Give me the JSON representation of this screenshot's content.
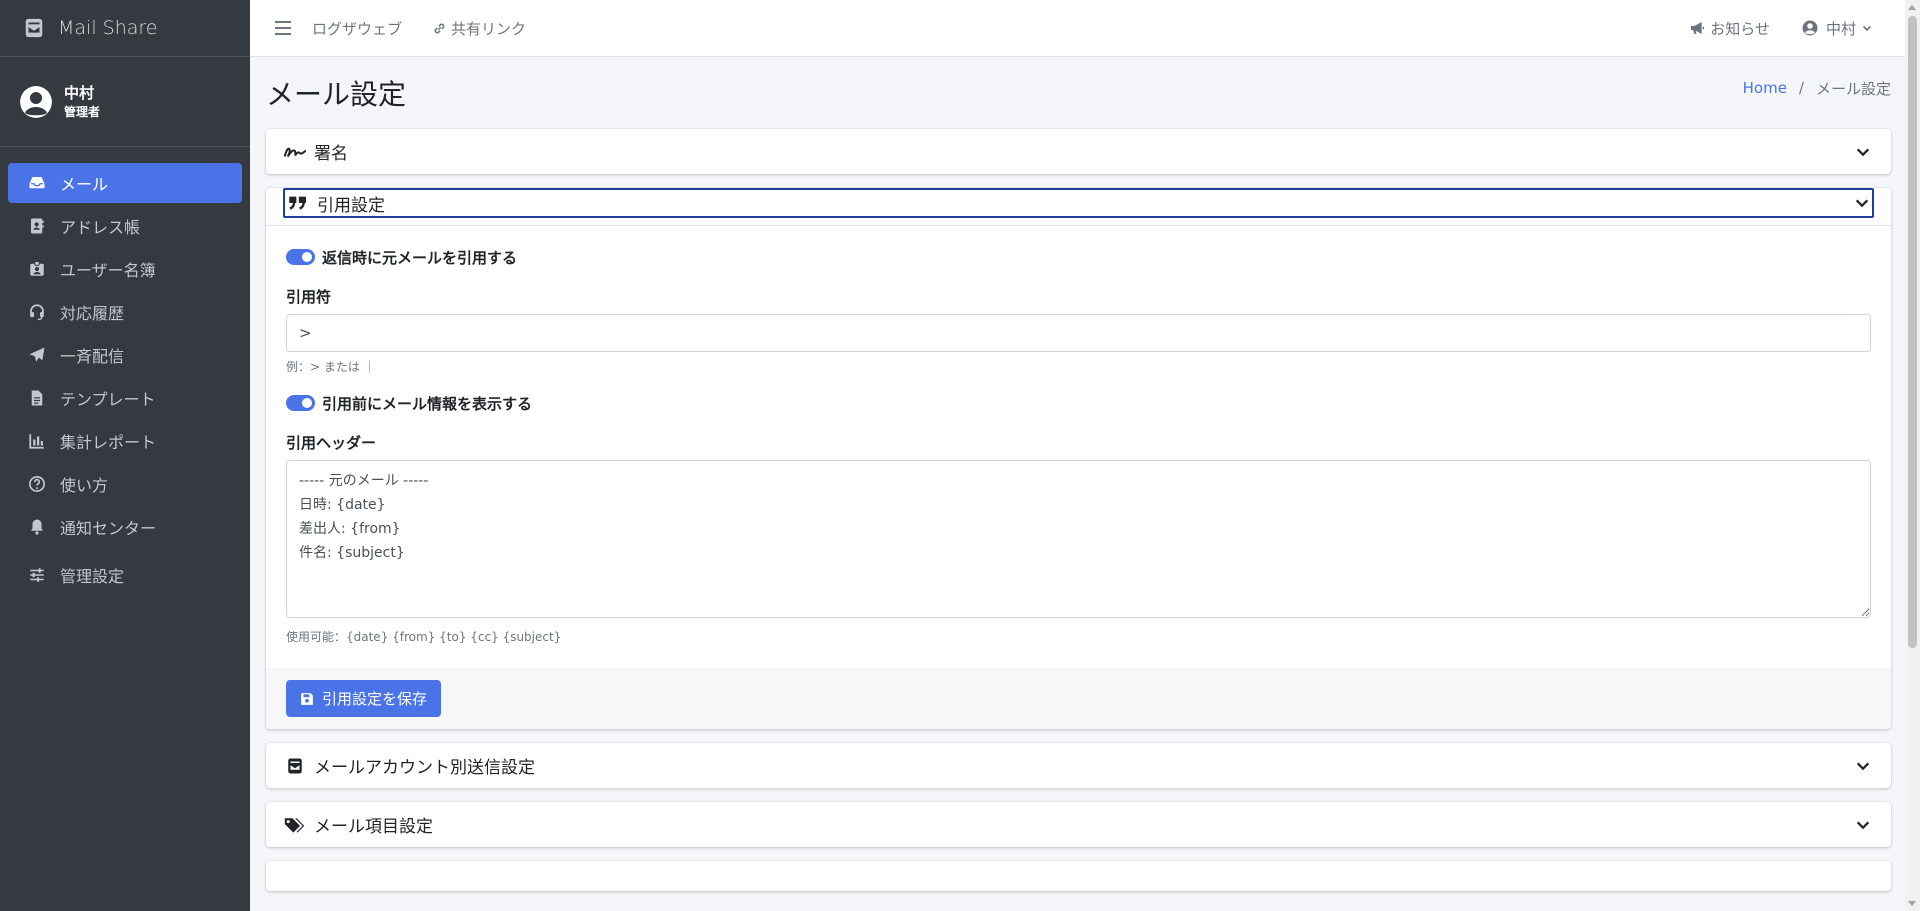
{
  "brand": {
    "name": "Mail Share"
  },
  "user": {
    "name": "中村",
    "role": "管理者"
  },
  "sidebar": {
    "items": [
      {
        "label": "メール",
        "icon": "inbox-icon",
        "active": true
      },
      {
        "label": "アドレス帳",
        "icon": "address-book-icon"
      },
      {
        "label": "ユーザー名簿",
        "icon": "id-badge-icon"
      },
      {
        "label": "対応履歴",
        "icon": "headset-icon"
      },
      {
        "label": "一斉配信",
        "icon": "paper-plane-icon"
      },
      {
        "label": "テンプレート",
        "icon": "file-icon"
      },
      {
        "label": "集計レポート",
        "icon": "chart-bar-icon"
      },
      {
        "label": "使い方",
        "icon": "question-circle-icon"
      },
      {
        "label": "通知センター",
        "icon": "bell-icon"
      },
      {
        "label": "管理設定",
        "icon": "sliders-icon"
      }
    ]
  },
  "topbar": {
    "links": [
      "ログザウェブ",
      "共有リンク"
    ],
    "notifications": "お知らせ",
    "user_menu": "中村"
  },
  "page": {
    "title": "メール設定",
    "breadcrumb": {
      "home": "Home",
      "separator": "/",
      "current": "メール設定"
    }
  },
  "sections": {
    "signature": {
      "title": "署名"
    },
    "quote": {
      "title": "引用設定",
      "toggle_quote": "返信時に元メールを引用する",
      "quote_mark_label": "引用符",
      "quote_mark_value": ">",
      "quote_mark_help": "例：> または ｜",
      "toggle_header": "引用前にメール情報を表示する",
      "header_label": "引用ヘッダー",
      "header_value": "----- 元のメール -----\n日時: {date}\n差出人: {from}\n件名: {subject}",
      "header_help": "使用可能：{date} {from} {to} {cc} {subject}",
      "save_button": "引用設定を保存"
    },
    "account_send": {
      "title": "メールアカウント別送信設定"
    },
    "mail_items": {
      "title": "メール項目設定"
    }
  },
  "colors": {
    "sidebar_bg": "#343a40",
    "accent": "#4a73e8",
    "focus_border": "#1f3f9e"
  }
}
